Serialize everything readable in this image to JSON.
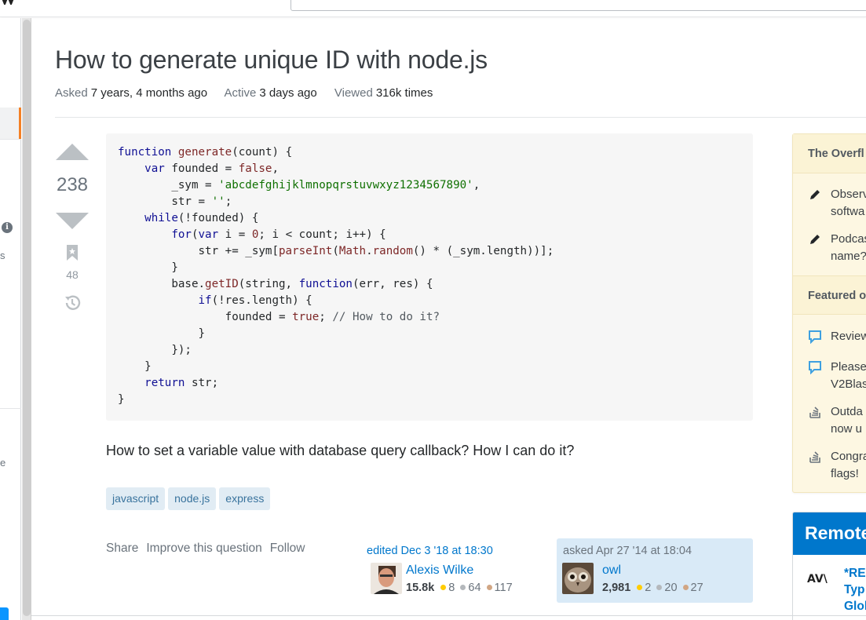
{
  "search": {
    "placeholder": ""
  },
  "leftnav": {
    "frag_s": "s",
    "frag_e": "e"
  },
  "question": {
    "title": "How to generate unique ID with node.js",
    "meta": [
      {
        "label": "Asked",
        "value": "7 years, 4 months ago"
      },
      {
        "label": "Active",
        "value": "3 days ago"
      },
      {
        "label": "Viewed",
        "value": "316k times"
      }
    ],
    "votes": "238",
    "bookmarks": "48",
    "body_text": "How to set a variable value with database query callback? How I can do it?",
    "tags": [
      "javascript",
      "node.js",
      "express"
    ],
    "post_menu": [
      "Share",
      "Improve this question",
      "Follow"
    ],
    "edited": {
      "time": "edited Dec 3 '18 at 18:30",
      "user": "Alexis Wilke",
      "rep": "15.8k",
      "gold": "8",
      "silver": "64",
      "bronze": "117"
    },
    "asked": {
      "time": "asked Apr 27 '14 at 18:04",
      "user": "owl",
      "rep": "2,981",
      "gold": "2",
      "silver": "20",
      "bronze": "27"
    },
    "code_lines": [
      "function generate(count) {",
      "    var founded = false,",
      "        _sym = 'abcdefghijklmnopqrstuvwxyz1234567890',",
      "        str = '';",
      "    while(!founded) {",
      "        for(var i = 0; i < count; i++) {",
      "            str += _sym[parseInt(Math.random() * (_sym.length))];",
      "        }",
      "        base.getID(string, function(err, res) {",
      "            if(!res.length) {",
      "                founded = true; // How to do it?",
      "            }",
      "        });",
      "    }",
      "    return str;",
      "}"
    ]
  },
  "sidebar": {
    "overflow_title": "The Overfl",
    "overflow_items": [
      {
        "icon": "pencil-icon",
        "line1": "Observ",
        "line2": "softwa"
      },
      {
        "icon": "pencil-icon",
        "line1": "Podcas",
        "line2": "name?"
      }
    ],
    "featured_title": "Featured o",
    "featured_items": [
      {
        "icon": "speech-bubble-icon",
        "line1": "Review",
        "line2": ""
      },
      {
        "icon": "speech-bubble-icon",
        "line1": "Please",
        "line2": "V2Blas"
      },
      {
        "icon": "stack-exchange-icon",
        "line1": "Outda",
        "line2": "now u"
      },
      {
        "icon": "stack-exchange-icon",
        "line1": "Congra",
        "line2": "flags!"
      }
    ],
    "remote_title": "Remote",
    "remote_logo": "AV\\",
    "remote_job": [
      "*RE",
      "Typ",
      "Glol"
    ]
  },
  "colors": {
    "link": "#0077cc",
    "tag_bg": "#e1ecf4",
    "tag_text": "#39739d",
    "accent": "#f48024",
    "yellow_box": "#fdf7e2"
  }
}
